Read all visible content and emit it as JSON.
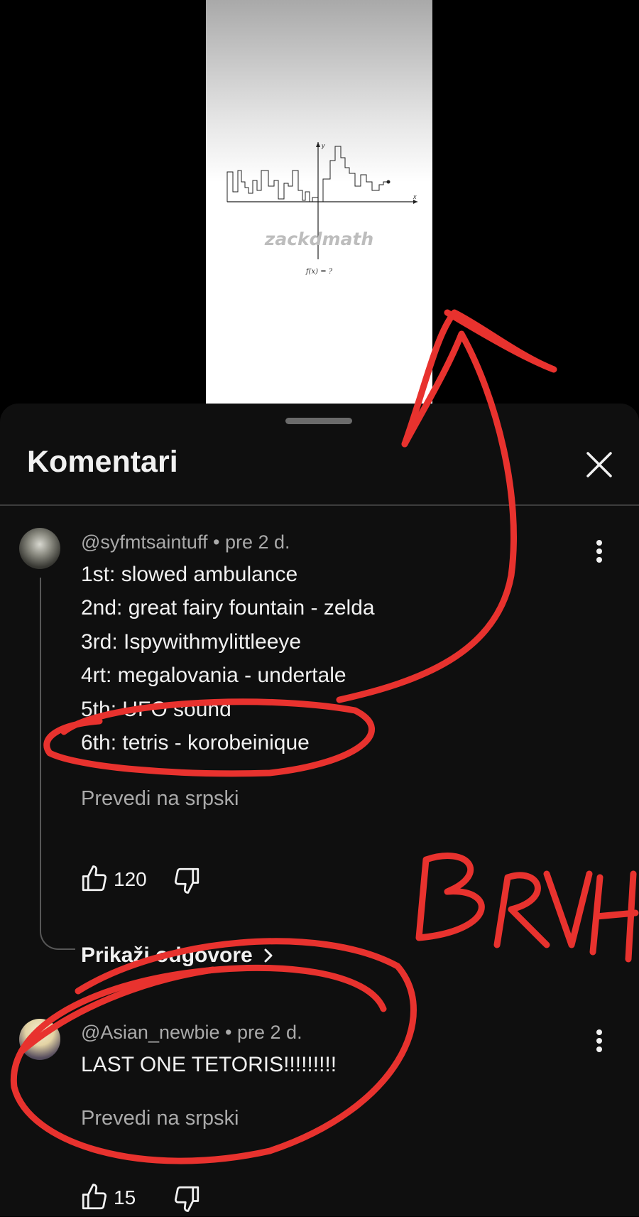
{
  "video": {
    "watermark": "zackdmath",
    "formula": "f(x) = ?"
  },
  "sheet": {
    "title": "Komentari",
    "close_icon": "close-icon"
  },
  "comments": [
    {
      "author": "@syfmtsaintuff",
      "time": "pre 2 d.",
      "lines": [
        "1st: slowed ambulance",
        "2nd: great fairy fountain - zelda",
        "3rd: Ispywithmylittleeye",
        "4rt: megalovania - undertale",
        "5th: UFO sound",
        "6th: tetris - korobeinique"
      ],
      "translate": "Prevedi na srpski",
      "likes": "120",
      "replies_label": "Prikaži odgovore"
    },
    {
      "author": "@Asian_newbie",
      "time": "pre 2 d.",
      "lines": [
        "LAST ONE TETORIS!!!!!!!!!"
      ],
      "translate": "Prevedi na srpski",
      "likes": "15"
    }
  ],
  "annotation": {
    "text": "BRVH",
    "color": "#e8322e"
  },
  "colors": {
    "sheet_bg": "#0f0f0f",
    "text": "#f1f1f1",
    "secondary": "#aaaaaa"
  }
}
